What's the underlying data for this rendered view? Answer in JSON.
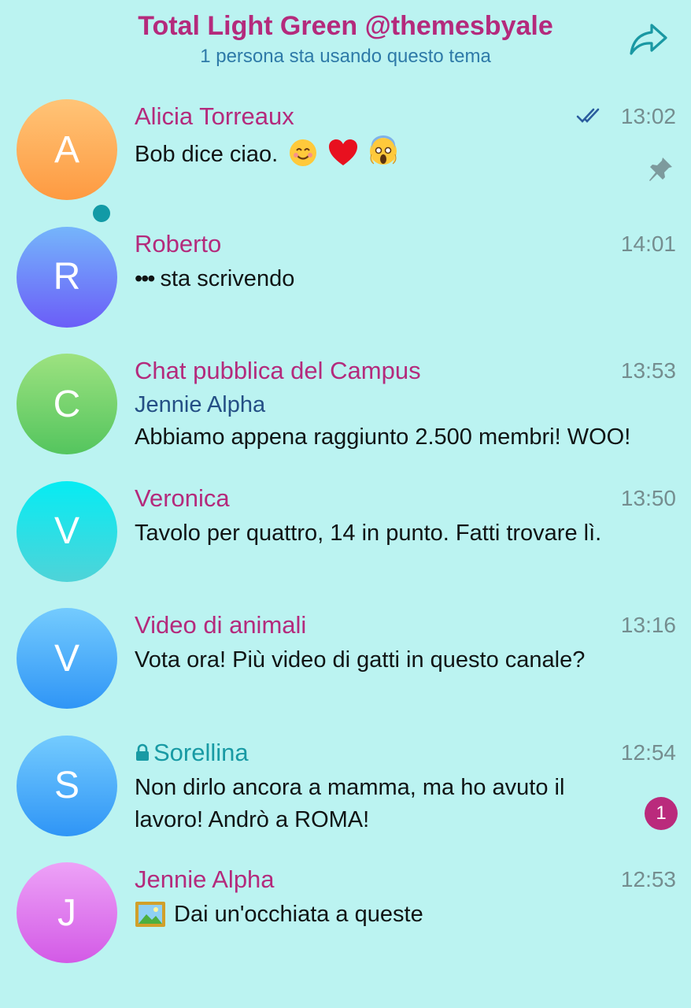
{
  "header": {
    "title": "Total Light Green @themesbyale",
    "subtitle": "1 persona sta usando questo tema",
    "share_icon": "share-arrow-icon"
  },
  "colors": {
    "background": "#bbf3f1",
    "accent": "#b42a7c",
    "secret_accent": "#189aa4",
    "badge": "#ba2a7c"
  },
  "chats": [
    {
      "initial": "A",
      "name": "Alicia Torreaux",
      "time": "13:02",
      "message": "Bob dice ciao.",
      "status": "read",
      "pinned": true
    },
    {
      "initial": "R",
      "name": "Roberto",
      "time": "14:01",
      "message": "sta scrivendo",
      "online": true
    },
    {
      "initial": "C",
      "name": "Chat pubblica del Campus",
      "time": "13:53",
      "sender": "Jennie Alpha",
      "message": "Abbiamo appena raggiunto 2.500 membri! WOO!"
    },
    {
      "initial": "V",
      "name": "Veronica",
      "time": "13:50",
      "message": "Tavolo per quattro, 14 in punto. Fatti trovare lì."
    },
    {
      "initial": "V",
      "name": "Video di animali",
      "time": "13:16",
      "message": "Vota ora! Più video di gatti in questo canale?"
    },
    {
      "initial": "S",
      "name": "Sorellina",
      "time": "12:54",
      "message": "Non dirlo ancora a mamma, ma ho avuto il lavoro! Andrò a ROMA!",
      "unread": "1",
      "secret": true
    },
    {
      "initial": "J",
      "name": "Jennie Alpha",
      "time": "12:53",
      "message": "Dai un'occhiata a queste"
    }
  ]
}
